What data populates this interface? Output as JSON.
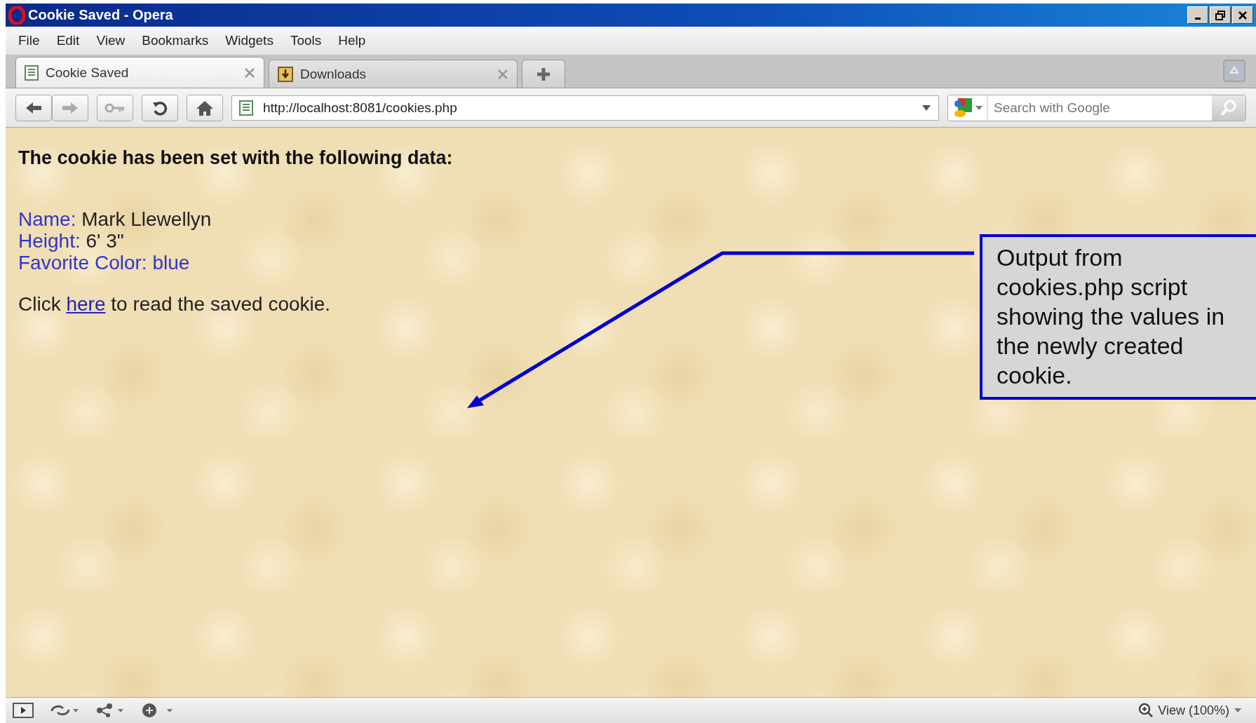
{
  "window": {
    "title": "Cookie Saved - Opera"
  },
  "menu": [
    "File",
    "Edit",
    "View",
    "Bookmarks",
    "Widgets",
    "Tools",
    "Help"
  ],
  "tabs": [
    {
      "label": "Cookie Saved",
      "selected": true,
      "kind": "page"
    },
    {
      "label": "Downloads",
      "selected": false,
      "kind": "downloads"
    }
  ],
  "address": {
    "value": "http://localhost:8081/cookies.php"
  },
  "search": {
    "placeholder": "Search with Google"
  },
  "page": {
    "heading": "The cookie has been set with the following data:",
    "fields": [
      {
        "label": "Name:",
        "value": "Mark Llewellyn",
        "color": "#222222"
      },
      {
        "label": "Height:",
        "value": "6' 3\"",
        "color": "#222222"
      },
      {
        "label": "Favorite Color:",
        "value": "blue",
        "color": "#3333cc"
      }
    ],
    "sentence": {
      "before": "Click",
      "link": "here",
      "after": "to read the saved cookie."
    }
  },
  "callout": {
    "text": "Output from cookies.php script showing the values in the newly created cookie."
  },
  "status_bar": {
    "zoom": "View (100%)"
  }
}
